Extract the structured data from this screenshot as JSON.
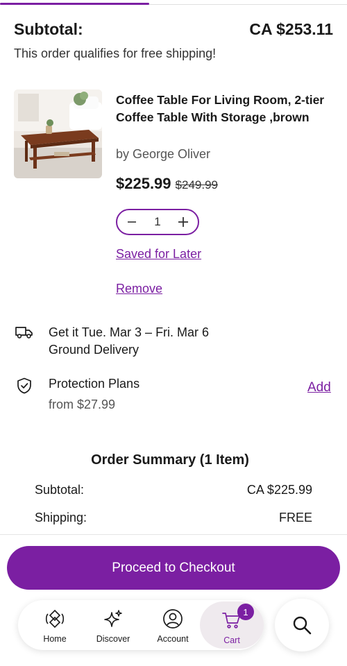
{
  "progress": {
    "fill_fraction": 0.43,
    "color": "#7b1fa2"
  },
  "summary_header": {
    "label": "Subtotal:",
    "value": "CA $253.11",
    "free_shipping_note": "This order qualifies for free shipping!"
  },
  "item": {
    "image_icon": "coffee-table-product-image",
    "title": "Coffee Table For Living Room, 2-tier Coffee Table With Storage ,brown",
    "brand": "by George Oliver",
    "price": "$225.99",
    "original_price": "$249.99",
    "quantity": "1",
    "decrement_icon": "minus",
    "increment_icon": "plus",
    "save_for_later_label": "Saved for Later",
    "remove_label": "Remove"
  },
  "delivery": {
    "icon": "truck-icon",
    "line1": "Get it Tue. Mar 3 – Fri. Mar 6",
    "line2": "Ground Delivery"
  },
  "protection": {
    "icon": "shield-check-icon",
    "title": "Protection Plans",
    "price": "from $27.99",
    "add_label": "Add"
  },
  "order_summary": {
    "title": "Order Summary (1 Item)",
    "rows": [
      {
        "label": "Subtotal:",
        "value": "CA $225.99"
      },
      {
        "label": "Shipping:",
        "value": "FREE"
      }
    ]
  },
  "checkout": {
    "label": "Proceed to Checkout",
    "color": "#7b1fa2"
  },
  "tabbar": {
    "tabs": [
      {
        "label": "Home",
        "icon": "home-icon"
      },
      {
        "label": "Discover",
        "icon": "sparkle-icon"
      },
      {
        "label": "Account",
        "icon": "account-icon"
      },
      {
        "label": "Cart",
        "icon": "cart-icon",
        "badge": "1",
        "active": true
      }
    ],
    "search_icon": "search-icon"
  }
}
